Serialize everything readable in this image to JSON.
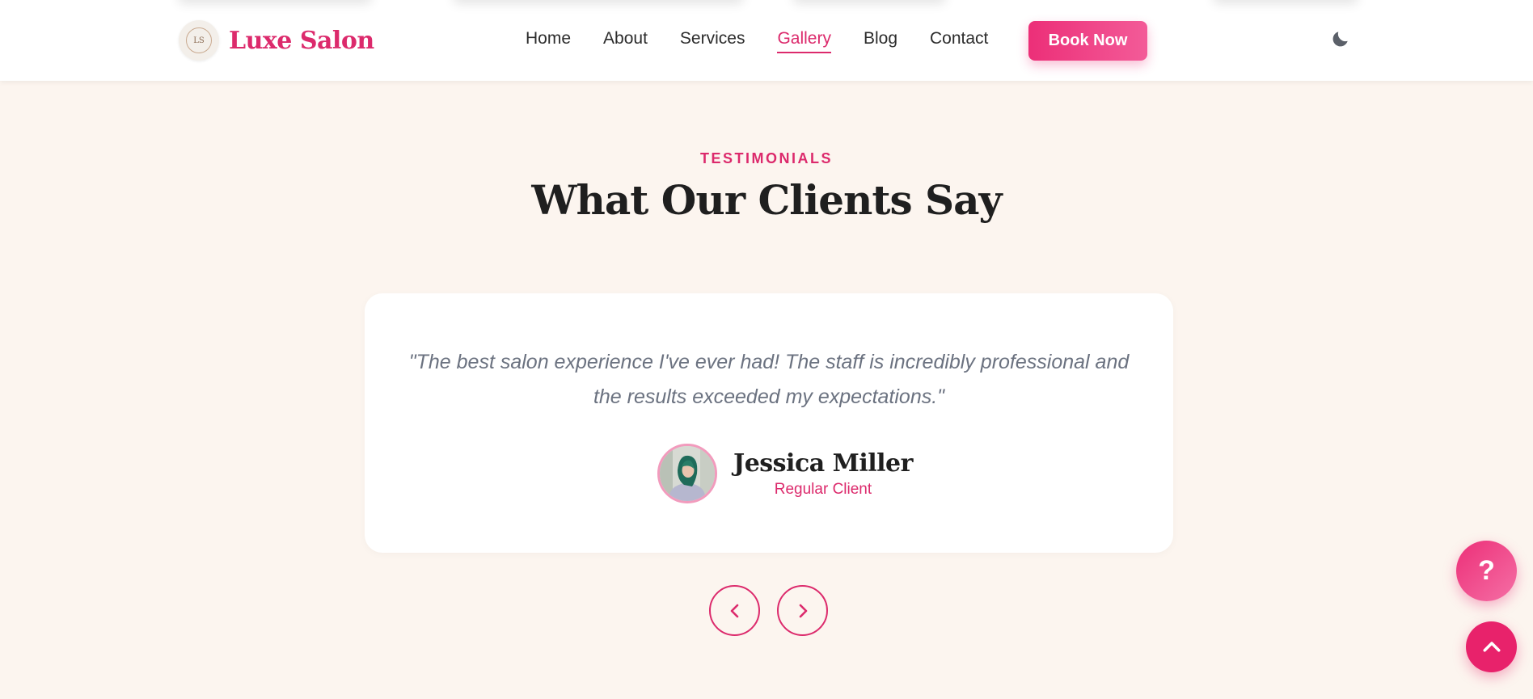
{
  "header": {
    "brand": {
      "logo_text": "LS",
      "name": "Luxe Salon"
    },
    "nav": [
      {
        "label": "Home",
        "active": false
      },
      {
        "label": "About",
        "active": false
      },
      {
        "label": "Services",
        "active": false
      },
      {
        "label": "Gallery",
        "active": true
      },
      {
        "label": "Blog",
        "active": false
      },
      {
        "label": "Contact",
        "active": false
      }
    ],
    "cta_label": "Book Now",
    "theme_toggle_icon": "moon-icon"
  },
  "testimonials": {
    "eyebrow": "TESTIMONIALS",
    "title": "What Our Clients Say",
    "current": {
      "quote": "\"The best salon experience I've ever had! The staff is incredibly professional and the results exceeded my expectations.\"",
      "author_name": "Jessica Miller",
      "author_role": "Regular Client"
    },
    "controls": {
      "prev_icon": "chevron-left-icon",
      "next_icon": "chevron-right-icon"
    }
  },
  "floating": {
    "help_label": "?",
    "scroll_top_icon": "chevron-up-icon"
  },
  "colors": {
    "accent": "#dc2a6c",
    "page_background": "#fcf5ef",
    "card_background": "#ffffff",
    "heading": "#1f1f1f",
    "muted_text": "#6b7280"
  }
}
